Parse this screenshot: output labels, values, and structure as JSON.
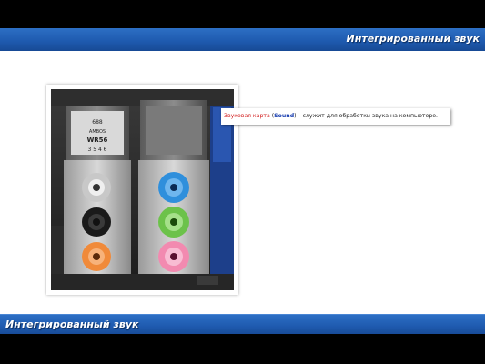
{
  "header": {
    "title": "Интегрированный звук"
  },
  "footer": {
    "title": "Интегрированный звук"
  },
  "caption": {
    "term": "Звуковая карта",
    "open_paren": " (",
    "sound": "Sound",
    "rest": ") – служит для обработки звука на компьютере."
  },
  "photo": {
    "label_left_1": "688",
    "label_left_2": "AMBOS",
    "label_left_3": "WR56",
    "label_left_4": "3 5 4 6"
  },
  "colors": {
    "bar_blue": "#1f5bb0",
    "jack_grey": "#c8c8c8",
    "jack_black": "#1a1a1a",
    "jack_orange": "#f08a3a",
    "jack_blue": "#2f8fdc",
    "jack_green": "#6cc24a",
    "jack_pink": "#f28ab0"
  }
}
